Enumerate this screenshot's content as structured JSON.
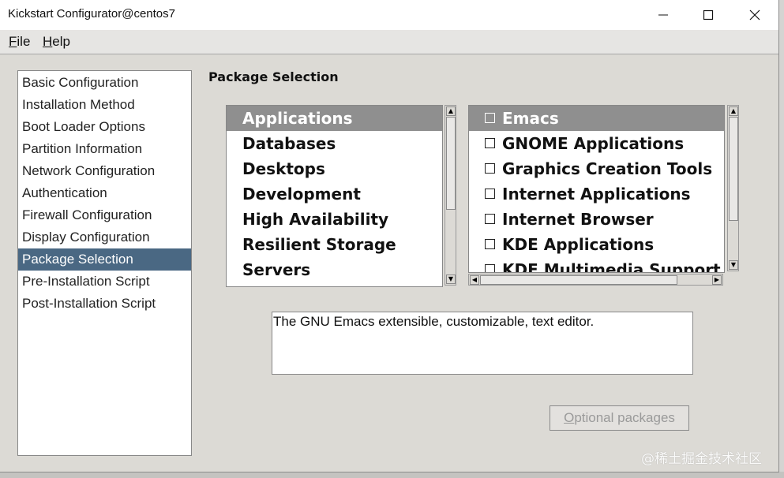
{
  "window": {
    "title": "Kickstart Configurator@centos7"
  },
  "menu": {
    "file_prefix": "F",
    "file_rest": "ile",
    "help_prefix": "H",
    "help_rest": "elp"
  },
  "nav": {
    "items": [
      {
        "label": "Basic Configuration"
      },
      {
        "label": "Installation Method"
      },
      {
        "label": "Boot Loader Options"
      },
      {
        "label": "Partition Information"
      },
      {
        "label": "Network Configuration"
      },
      {
        "label": "Authentication"
      },
      {
        "label": "Firewall Configuration"
      },
      {
        "label": "Display Configuration"
      },
      {
        "label": "Package Selection",
        "selected": true
      },
      {
        "label": "Pre-Installation Script"
      },
      {
        "label": "Post-Installation Script"
      }
    ]
  },
  "main": {
    "section_title": "Package Selection",
    "groups": [
      {
        "label": "Applications",
        "selected": true
      },
      {
        "label": "Databases"
      },
      {
        "label": "Desktops"
      },
      {
        "label": "Development"
      },
      {
        "label": "High Availability"
      },
      {
        "label": "Resilient Storage"
      },
      {
        "label": "Servers"
      }
    ],
    "packages": [
      {
        "label": "Emacs",
        "selected": true,
        "checked": false
      },
      {
        "label": "GNOME Applications",
        "checked": false
      },
      {
        "label": "Graphics Creation Tools",
        "checked": false
      },
      {
        "label": "Internet Applications",
        "checked": false
      },
      {
        "label": "Internet Browser",
        "checked": false
      },
      {
        "label": "KDE Applications",
        "checked": false
      },
      {
        "label": "KDE Multimedia Support",
        "checked": false
      }
    ],
    "description": "The GNU Emacs extensible, customizable, text editor.",
    "optional_prefix": "O",
    "optional_rest": "ptional packages"
  },
  "watermark": "@稀土掘金技术社区"
}
